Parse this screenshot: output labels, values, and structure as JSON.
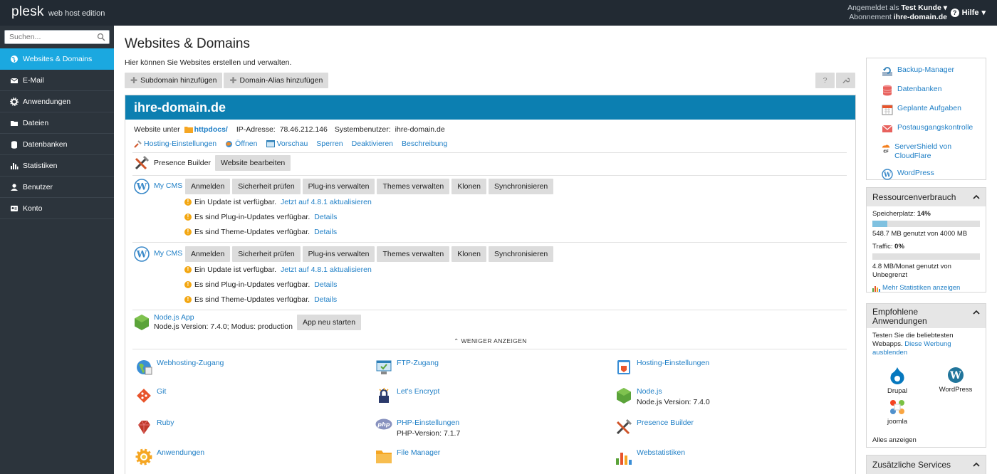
{
  "topbar": {
    "logo_main": "plesk",
    "logo_sub": "web host edition",
    "logged_in_label": "Angemeldet als",
    "user": "Test Kunde",
    "subscription_label": "Abonnement",
    "subscription": "ihre-domain.de",
    "help": "Hilfe"
  },
  "sidebar": {
    "search_placeholder": "Suchen...",
    "items": [
      {
        "label": "Websites & Domains",
        "icon": "globe-icon"
      },
      {
        "label": "E-Mail",
        "icon": "mail-icon"
      },
      {
        "label": "Anwendungen",
        "icon": "gear-icon"
      },
      {
        "label": "Dateien",
        "icon": "folder-icon"
      },
      {
        "label": "Datenbanken",
        "icon": "database-icon"
      },
      {
        "label": "Statistiken",
        "icon": "bar-chart-icon"
      },
      {
        "label": "Benutzer",
        "icon": "user-icon"
      },
      {
        "label": "Konto",
        "icon": "account-icon"
      }
    ]
  },
  "main": {
    "title": "Websites & Domains",
    "description": "Hier können Sie Websites erstellen und verwalten.",
    "toolbar": {
      "add_subdomain": "Subdomain hinzufügen",
      "add_alias": "Domain-Alias hinzufügen",
      "help_btn": "?"
    },
    "domain": {
      "name": "ihre-domain.de",
      "website_under": "Website unter",
      "docroot": "httpdocs/",
      "ip_label": "IP-Adresse:",
      "ip": "78.46.212.146",
      "sysuser_label": "Systembenutzer:",
      "sysuser": "ihre-domain.de",
      "actions": [
        "Hosting-Einstellungen",
        "Öffnen",
        "Vorschau",
        "Sperren",
        "Deaktivieren",
        "Beschreibung"
      ],
      "presence_builder": "Presence Builder",
      "edit_website": "Website bearbeiten",
      "cms_blocks": [
        {
          "name": "My CMS",
          "buttons": [
            "Anmelden",
            "Sicherheit prüfen",
            "Plug-ins verwalten",
            "Themes verwalten",
            "Klonen",
            "Synchronisieren"
          ],
          "update_text": "Ein Update ist verfügbar.",
          "update_link": "Jetzt auf 4.8.1 aktualisieren",
          "plugin_text": "Es sind Plug-in-Updates verfügbar.",
          "theme_text": "Es sind Theme-Updates verfügbar.",
          "details": "Details"
        },
        {
          "name": "My CMS",
          "buttons": [
            "Anmelden",
            "Sicherheit prüfen",
            "Plug-ins verwalten",
            "Themes verwalten",
            "Klonen",
            "Synchronisieren"
          ],
          "update_text": "Ein Update ist verfügbar.",
          "update_link": "Jetzt auf 4.8.1 aktualisieren",
          "plugin_text": "Es sind Plug-in-Updates verfügbar.",
          "theme_text": "Es sind Theme-Updates verfügbar.",
          "details": "Details"
        }
      ],
      "node": {
        "name": "Node.js App",
        "info": "Node.js Version: 7.4.0; Modus: production",
        "restart": "App neu starten"
      },
      "show_less": "WENIGER ANZEIGEN",
      "tiles": [
        {
          "label": "Webhosting-Zugang",
          "sub": "",
          "icon": "webhosting-icon"
        },
        {
          "label": "FTP-Zugang",
          "sub": "",
          "icon": "ftp-icon"
        },
        {
          "label": "Hosting-Einstellungen",
          "sub": "",
          "icon": "hosting-settings-icon"
        },
        {
          "label": "Git",
          "sub": "",
          "icon": "git-icon"
        },
        {
          "label": "Let's Encrypt",
          "sub": "",
          "icon": "lets-encrypt-icon"
        },
        {
          "label": "Node.js",
          "sub": "Node.js Version: 7.4.0",
          "icon": "nodejs-icon"
        },
        {
          "label": "Ruby",
          "sub": "",
          "icon": "ruby-icon"
        },
        {
          "label": "PHP-Einstellungen",
          "sub": "PHP-Version: 7.1.7",
          "icon": "php-icon"
        },
        {
          "label": "Presence Builder",
          "sub": "",
          "icon": "presence-builder-icon"
        },
        {
          "label": "Anwendungen",
          "sub": "",
          "icon": "applications-icon"
        },
        {
          "label": "File Manager",
          "sub": "",
          "icon": "file-manager-icon"
        },
        {
          "label": "Webstatistiken",
          "sub": "",
          "icon": "web-stats-icon"
        }
      ]
    }
  },
  "right": {
    "links": [
      {
        "label": "Backup-Manager",
        "icon": "backup-icon"
      },
      {
        "label": "Datenbanken",
        "icon": "database-icon"
      },
      {
        "label": "Geplante Aufgaben",
        "icon": "calendar-icon"
      },
      {
        "label": "Postausgangskontrolle",
        "icon": "mail-icon"
      },
      {
        "label": "ServerShield von CloudFlare",
        "icon": "cloudflare-icon"
      },
      {
        "label": "WordPress",
        "icon": "wordpress-icon"
      }
    ],
    "resources": {
      "title": "Ressourcenverbrauch",
      "disk_label": "Speicherplatz:",
      "disk_pct": "14%",
      "disk_fraction": 0.14,
      "disk_text": "548.7 MB genutzt von 4000 MB",
      "traffic_label": "Traffic:",
      "traffic_pct": "0%",
      "traffic_fraction": 0,
      "traffic_text": "4.8 MB/Monat genutzt von Unbegrenzt",
      "more_stats": "Mehr Statistiken anzeigen"
    },
    "recommended": {
      "title": "Empfohlene Anwendungen",
      "text": "Testen Sie die beliebtesten Webapps.",
      "hide_link": "Diese Werbung ausblenden",
      "apps": [
        "Drupal",
        "WordPress",
        "joomla"
      ],
      "show_all": "Alles anzeigen"
    },
    "services": {
      "title": "Zusätzliche Services"
    }
  }
}
